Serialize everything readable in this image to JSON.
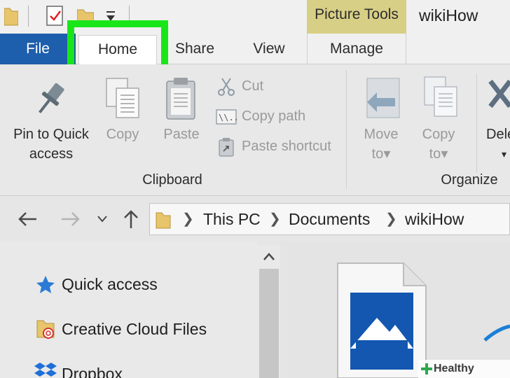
{
  "window": {
    "title": "wikiHow",
    "context_tab_group": "Picture Tools"
  },
  "tabs": {
    "file": "File",
    "home": "Home",
    "share": "Share",
    "view": "View",
    "manage": "Manage"
  },
  "ribbon": {
    "clipboard": {
      "pin_line1": "Pin to Quick",
      "pin_line2": "access",
      "copy": "Copy",
      "paste": "Paste",
      "cut": "Cut",
      "copy_path": "Copy path",
      "paste_shortcut": "Paste shortcut",
      "group_label": "Clipboard"
    },
    "organize": {
      "move_line1": "Move",
      "move_line2": "to",
      "copy_line1": "Copy",
      "copy_line2": "to",
      "delete_partial": "Dele",
      "group_label": "Organize"
    }
  },
  "address": {
    "crumbs": [
      "This PC",
      "Documents",
      "wikiHow"
    ]
  },
  "nav_pane": {
    "items": [
      "Quick access",
      "Creative Cloud Files",
      "Dropbox"
    ]
  },
  "watermark": "Healthy Living",
  "colors": {
    "file_tab": "#1e5fad",
    "picture_tools": "#d8cf86",
    "highlight": "#19e619",
    "dropbox": "#1e6fd8",
    "quick_access_star": "#2a7bd6"
  }
}
